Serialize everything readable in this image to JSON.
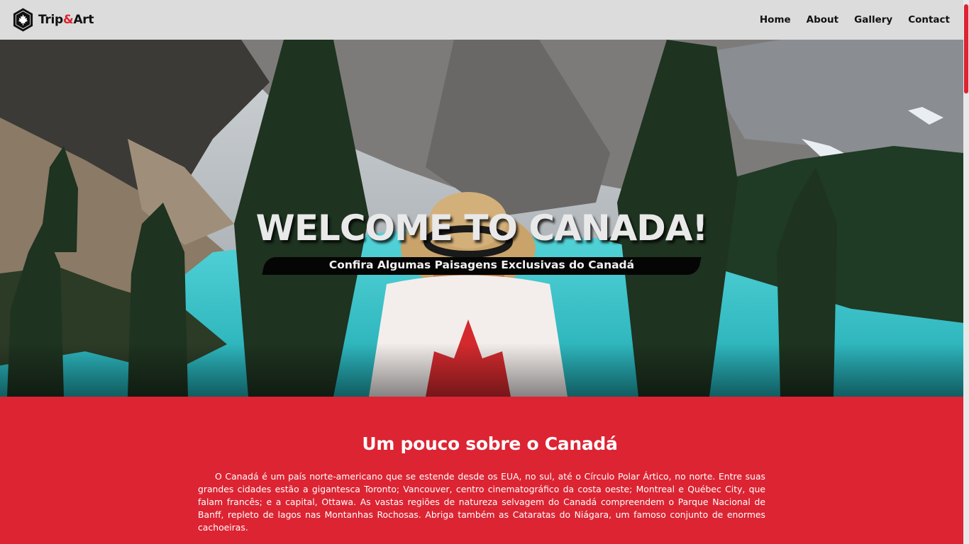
{
  "brand": {
    "name_part1": "Trip",
    "name_amp": "&",
    "name_part2": "Art",
    "logo_icon": "hexagon-maple-leaf-icon"
  },
  "nav": {
    "items": [
      {
        "label": "Home"
      },
      {
        "label": "About"
      },
      {
        "label": "Gallery"
      },
      {
        "label": "Contact"
      }
    ]
  },
  "hero": {
    "title": "WELCOME TO CANADA!",
    "subtitle": "Confira Algumas Paisagens Exclusivas do Canadá"
  },
  "about": {
    "title": "Um pouco sobre o Canadá",
    "text": "O Canadá é um país norte-americano que se estende desde os EUA, no sul, até o Círculo Polar Ártico, no norte. Entre suas grandes cidades estão a gigantesca Toronto; Vancouver, centro cinematográfico da costa oeste; Montreal e Québec City, que falam francês; e a capital, Ottawa. As vastas regiões de natureza selvagem do Canadá compreendem o Parque Nacional de Banff, repleto de lagos nas Montanhas Rochosas. Abriga também as Cataratas do Niágara, um famoso conjunto de enormes cachoeiras."
  },
  "colors": {
    "accent": "#dc2433",
    "navbar_bg": "#dcdcdc",
    "lake": "#2fc1c9"
  }
}
